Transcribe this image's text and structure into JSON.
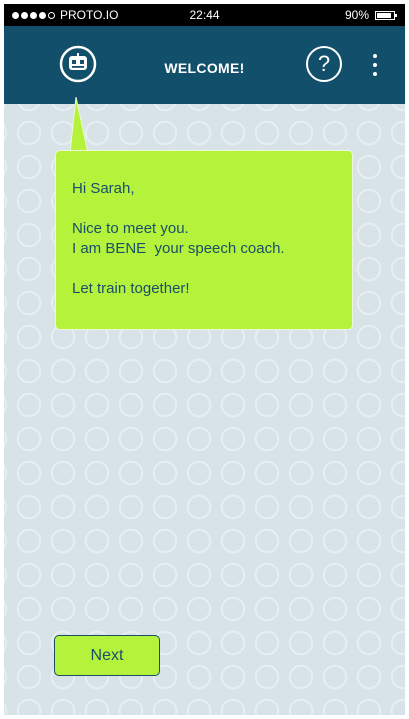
{
  "status_bar": {
    "carrier": "PROTO.IO",
    "time": "22:44",
    "battery_percent": "90%",
    "battery_level": 0.9,
    "signal_bars_filled": 4,
    "signal_bars_total": 5
  },
  "header": {
    "title": "WELCOME!",
    "help_label": "?",
    "left_icon": "robot-face-icon",
    "right_icon": "more-vertical-icon",
    "background_color": "#124f6b"
  },
  "bubble": {
    "greeting": "Hi Sarah,",
    "intro_line1": "Nice to meet you.",
    "intro_line2": "I am BENE  your speech coach.",
    "closing": "Let train together!",
    "background_color": "#b4f23c",
    "text_color": "#1a4f6a"
  },
  "next_button": {
    "label": "Next"
  },
  "colors": {
    "background": "#d8e3e8",
    "pattern": "#e7eef2"
  }
}
